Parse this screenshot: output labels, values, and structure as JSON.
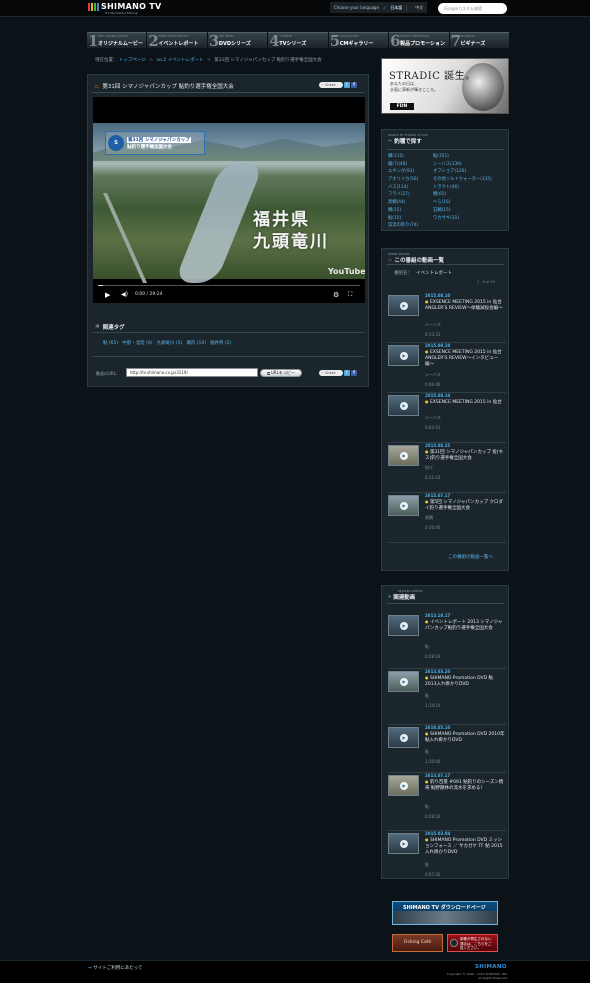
{
  "header": {
    "logo_text": "SHIMANO TV",
    "logo_tagline": "It's Wonderful Fishing!",
    "language_label": "Choose your language",
    "language_selected": "日本語",
    "language_other": "中文",
    "search_placeholder": "Googleカスタム検索"
  },
  "nav": [
    {
      "num": "1",
      "sub": "NEXT ORIGINAL MOVIES",
      "label": "オリジナルムービー"
    },
    {
      "num": "2",
      "sub": "EVENT REPORT MOVIES",
      "label": "イベントレポート"
    },
    {
      "num": "3",
      "sub": "DVD SERIES",
      "label": "DVDシリーズ"
    },
    {
      "num": "4",
      "sub": "TV SERIES",
      "label": "TVシリーズ"
    },
    {
      "num": "5",
      "sub": "TVCM GALLERY",
      "label": "CMギャラリー"
    },
    {
      "num": "6",
      "sub": "PRODUCT PROMOTION",
      "label": "製品プロモーション"
    },
    {
      "num": "7",
      "sub": "BEGINNERS",
      "label": "ビギナーズ"
    }
  ],
  "breadcrumb": {
    "label": "現在位置：",
    "items": [
      "トップページ",
      "vo.2 イベントレポート",
      "第31回 シマノジャパンカップ 鮎釣り選手権全国大会"
    ]
  },
  "video_page": {
    "title": "第31回 シマノジャパンカップ 鮎釣り選手権全国大会",
    "check_label": "Check",
    "twitter_label": "t",
    "facebook_label": "f",
    "video": {
      "badge_line1": "第31回 シマノジャパンカップ",
      "badge_line2": "鮎釣り選手権全国大会",
      "emblem_text": "S",
      "overlay_line1": "福井県",
      "overlay_line2": "九頭竜川",
      "youtube_label": "YouTube",
      "time": "0:00 / 29:24"
    },
    "related_tags_title": "関連タグ",
    "tags": [
      "鮎 (65)",
      "中部・北陸 (6)",
      "九頭竜川 (5)",
      "瀬内 (10)",
      "福井県 (2)"
    ],
    "url_label": "動画のURL：",
    "url_value": "http://tv.shimano.co.jp/3119/",
    "copy_button": "URLをコピー"
  },
  "ad": {
    "title": "STRADIC 誕生。",
    "line1": "あなたの日は、",
    "line2": "水面に革新が輝きこころ。",
    "logo": "FDN"
  },
  "species": {
    "sub": "SEARCH BY FISHING STYLES",
    "title": "釣種で探す",
    "items": [
      "鯛(110)",
      "鮎(351)",
      "磯(7)(48)",
      "シーバス(136)",
      "エギング(93)",
      "オフショア(126)",
      "アオリイカ(56)",
      "その他ソルトウォーター(135)",
      "バス(114)",
      "トラウト(46)",
      "フライ(27)",
      "鯉(65)",
      "黒鯛(44)",
      "へら(16)",
      "鯛(15)",
      "石鯛(15)",
      "鮎(15)",
      "ワカサギ(31)",
      "渓流の釣り(74)",
      ""
    ]
  },
  "genre": {
    "sub": "GENRE MOVIES",
    "title": "この番組の動画一覧",
    "selector_label": "番組名：",
    "selector_value": "イベントレポート",
    "count": "1 - 5 of 43",
    "items": [
      {
        "date": "2015.08.10",
        "title": "EXSENCE MEETING 2015 in 仙台 ANGLER'S REVIEW〜体験試投会編〜",
        "cat": "シーバス",
        "dur": "0:13:31"
      },
      {
        "date": "2015.08.10",
        "title": "EXSENCE MEETING 2015 in 仙台 ANGLER'S REVIEW〜インタビュー編〜",
        "cat": "シーバス",
        "dur": "0:06:46"
      },
      {
        "date": "2015.08.10",
        "title": "EXSENCE MEETING 2015 in 仙台",
        "cat": "シーバス",
        "dur": "0:02:41"
      },
      {
        "date": "2015.08.25",
        "title": "第31回 シマノジャパンカップ 投(キス)釣り選手権全国大会",
        "cat": "投げ",
        "dur": "0:11:03"
      },
      {
        "date": "2015.07.17",
        "title": "第5回 シマノジャパンカップ クロダイ釣り選手権全国大会",
        "cat": "黒鯛",
        "dur": "0:36:40"
      }
    ],
    "more_link": "この番組の動画一覧へ"
  },
  "related": {
    "sub": "RELATED VIDEOS",
    "title": "関連動画",
    "items": [
      {
        "date": "2013.10.17",
        "title": "イベントレポート 2013 シマノジャパンカップ鮎釣り選手権全国大会",
        "cat": "鮎",
        "dur": "0:28:19"
      },
      {
        "date": "2013.03.20",
        "title": "SHIMANO Promotion DVD 鮎 2013入れ掛かりDVD",
        "cat": "鮎",
        "dur": "1:14:10"
      },
      {
        "date": "2010.05.10",
        "title": "SHIMANO Promotion DVD 2010年 鮎入れ掛かりDVD",
        "cat": "鮎",
        "dur": "1:20:00"
      },
      {
        "date": "2013.07.17",
        "title": "釣り百景 #091 鮎釣りのシーズン携帯 鮎野題林の流水を求める！",
        "cat": "鮎",
        "dur": "0:28:10"
      },
      {
        "date": "2015.03.04",
        "title": "SHIMANO Promotion DVD ミッションフォース ／ サカガケ TF 鮎 2015入れ掛かりDVD",
        "cat": "鮎",
        "dur": "0:07:20"
      }
    ]
  },
  "banners": {
    "download_title": "SHIMANO TV ダウンロードページ",
    "cafe_label": "Fishing Café",
    "promo2_line1": "映像が再生されない",
    "promo2_line2": "場合は、こちらをご",
    "promo2_line3": "覧ください。"
  },
  "footer": {
    "link": "サイトご利用にあたって",
    "logo": "SHIMANO",
    "copyright1": "Copyright © 1996 - 2015 SHIMANO, INC.",
    "copyright2": "All Rights Reserved."
  },
  "colors": {
    "accent_blue": "#2c8fdb",
    "link_blue": "#5ab4e8",
    "background": "#0c1318",
    "panel": "#1b252c"
  }
}
